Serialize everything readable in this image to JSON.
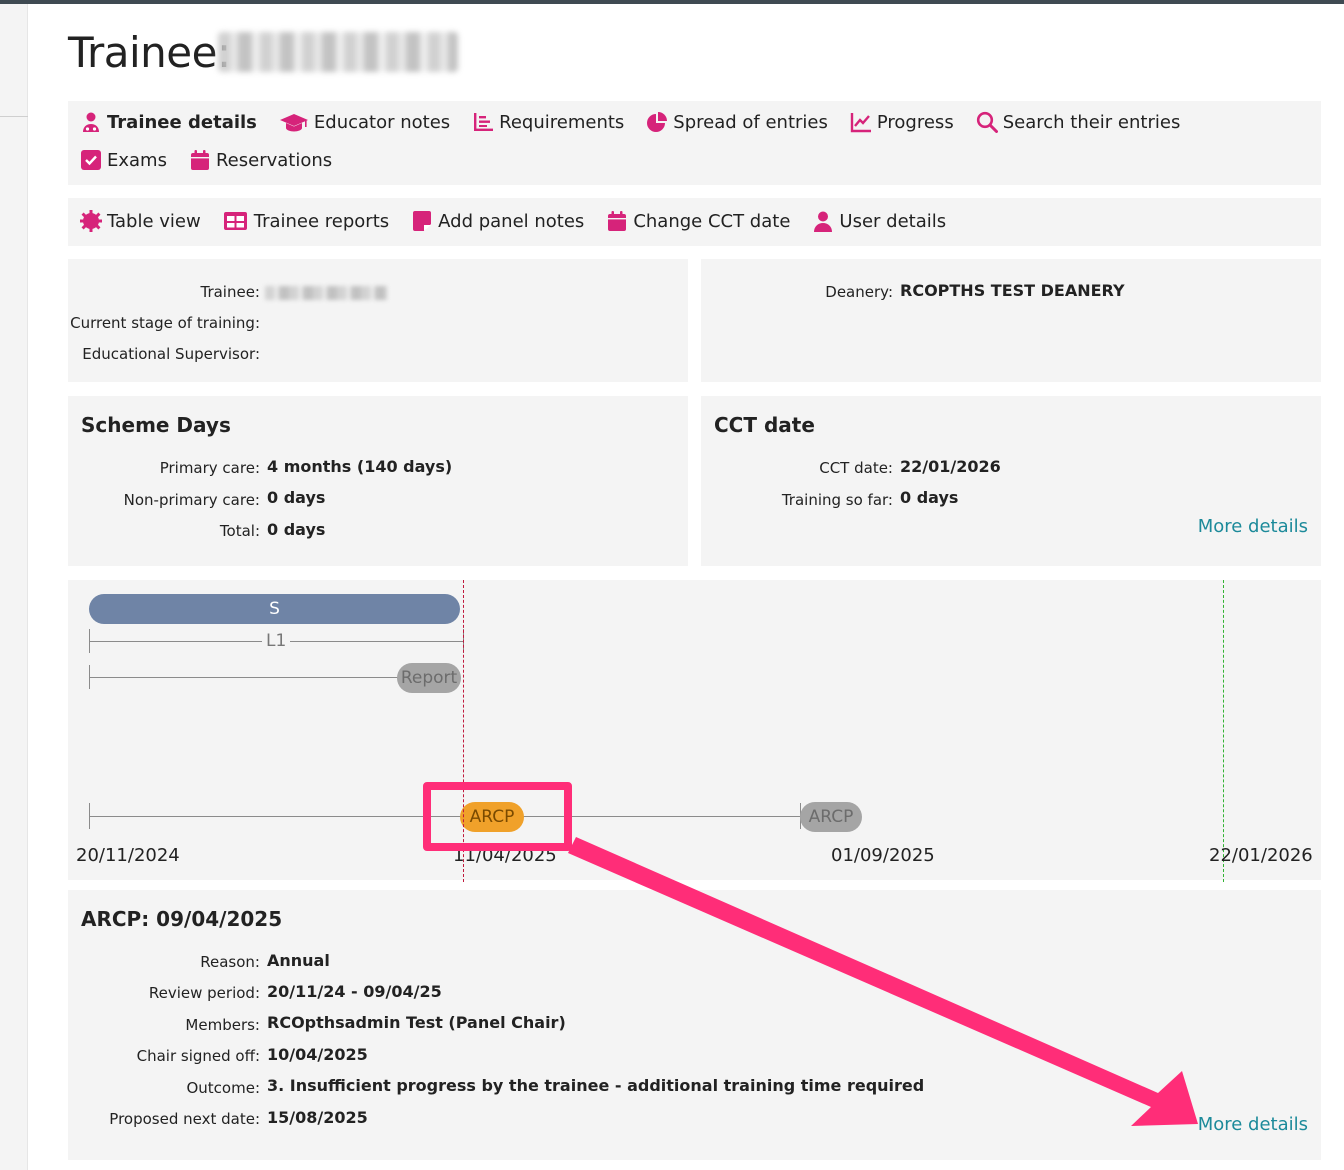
{
  "page": {
    "title": "Trainee:"
  },
  "nav_primary": [
    {
      "label": "Trainee details",
      "icon": "user-doctor-icon"
    },
    {
      "label": "Educator notes",
      "icon": "graduation-cap-icon"
    },
    {
      "label": "Requirements",
      "icon": "list-chart-icon"
    },
    {
      "label": "Spread of entries",
      "icon": "pie-chart-icon"
    },
    {
      "label": "Progress",
      "icon": "line-chart-icon"
    },
    {
      "label": "Search their entries",
      "icon": "search-icon"
    },
    {
      "label": "Exams",
      "icon": "checkbox-icon"
    },
    {
      "label": "Reservations",
      "icon": "calendar-icon"
    }
  ],
  "nav_secondary": [
    {
      "label": "Table view",
      "icon": "gear-icon"
    },
    {
      "label": "Trainee reports",
      "icon": "table-icon"
    },
    {
      "label": "Add panel notes",
      "icon": "sticky-note-icon"
    },
    {
      "label": "Change CCT date",
      "icon": "calendar-icon"
    },
    {
      "label": "User details",
      "icon": "user-icon"
    }
  ],
  "trainee_info": {
    "trainee_label": "Trainee:",
    "stage_label": "Current stage of training:",
    "supervisor_label": "Educational Supervisor:",
    "deanery_label": "Deanery:",
    "deanery_value": "RCOPTHS TEST DEANERY"
  },
  "scheme_days": {
    "title": "Scheme Days",
    "primary_label": "Primary care:",
    "primary_value": "4 months (140 days)",
    "nonprimary_label": "Non-primary care:",
    "nonprimary_value": "0 days",
    "total_label": "Total:",
    "total_value": "0 days"
  },
  "cct": {
    "title": "CCT date",
    "date_label": "CCT date:",
    "date_value": "22/01/2026",
    "training_label": "Training so far:",
    "training_value": "0 days",
    "more_link": "More details"
  },
  "timeline": {
    "bar_label": "S",
    "line_label": "L1",
    "report_label": "Report",
    "arcp_current": "ARCP",
    "arcp_next": "ARCP",
    "dates": [
      "20/11/2024",
      "11/04/2025",
      "01/09/2025",
      "22/01/2026"
    ]
  },
  "arcp": {
    "title": "ARCP: 09/04/2025",
    "reason_label": "Reason:",
    "reason_value": "Annual",
    "period_label": "Review period:",
    "period_value": "20/11/24 - 09/04/25",
    "members_label": "Members:",
    "members_value": "RCOpthsadmin Test (Panel Chair)",
    "chair_label": "Chair signed off:",
    "chair_value": "10/04/2025",
    "outcome_label": "Outcome:",
    "outcome_value": "3. Insufficient progress by the trainee - additional training time required",
    "next_label": "Proposed next date:",
    "next_value": "15/08/2025",
    "more_link": "More details"
  },
  "colors": {
    "accent": "#d6237a",
    "link": "#1c8a9a",
    "highlight": "#ff2d78",
    "bar": "#6f84a6",
    "arcp": "#f0a12a"
  }
}
